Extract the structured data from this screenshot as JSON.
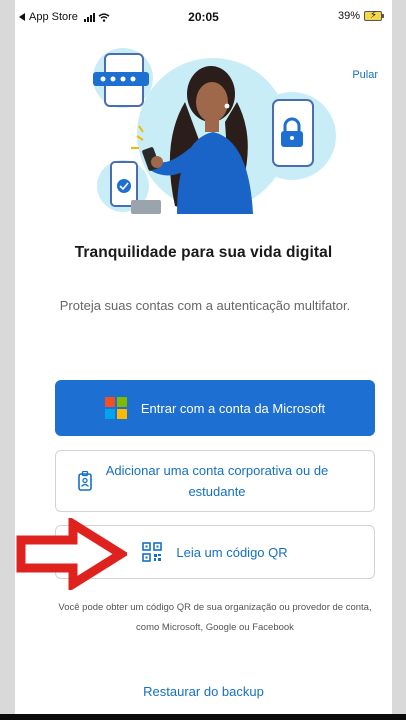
{
  "status_bar": {
    "back_app": "App Store",
    "time": "20:05",
    "battery": "39%"
  },
  "header": {
    "skip_label": "Pular"
  },
  "onboarding": {
    "title": "Tranquilidade para sua vida digital",
    "subtitle": "Proteja suas contas com a autenticação multifator."
  },
  "actions": {
    "microsoft_signin_label": "Entrar com a conta da Microsoft",
    "add_work_account_label": "Adicionar uma conta corporativa ou de estudante",
    "scan_qr_label": "Leia um código QR"
  },
  "info": {
    "qr_hint": "Você pode obter um código QR de sua organização ou provedor de conta, como Microsoft, Google ou Facebook"
  },
  "footer": {
    "restore_label": "Restaurar do backup"
  },
  "colors": {
    "primary_blue": "#1d6fd2",
    "link_blue": "#1470c4",
    "annotation_red": "#e0221f",
    "ms_red": "#f25022",
    "ms_green": "#7fba00",
    "ms_blue": "#00a4ef",
    "ms_yellow": "#ffb900"
  },
  "icons": {
    "microsoft": "microsoft-logo-icon",
    "badge": "id-badge-icon",
    "qr": "qr-code-icon",
    "annotation": "red-arrow-annotation"
  }
}
